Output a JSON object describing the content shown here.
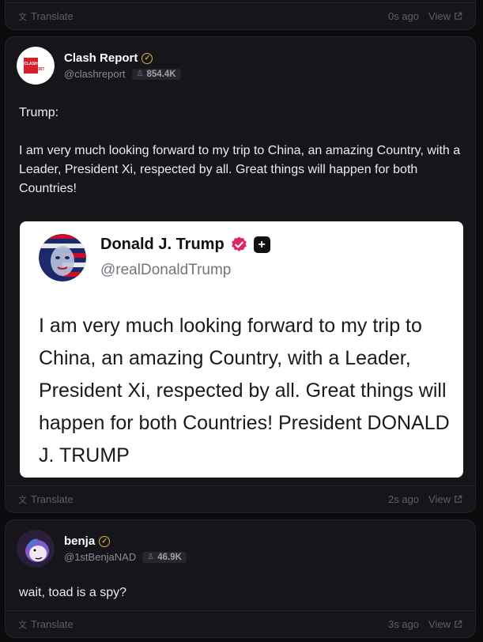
{
  "top_card": {
    "translate_label": "Translate",
    "time": "0s ago",
    "view_label": "View"
  },
  "post1": {
    "author_name": "Clash Report",
    "handle": "@clashreport",
    "followers": "854.4K",
    "avatar_text": "CLASH REPORT",
    "text": "Trump:\n\nI am very much looking forward to my trip to China, an amazing Country, with a Leader, President Xi, respected by all. Great things will happen for both Countries!",
    "quote": {
      "name": "Donald J. Trump",
      "handle": "@realDonaldTrump",
      "text": "I am very much looking forward to my trip to China, an amazing Country, with a Leader, President Xi, respected by all. Great things will happen for both Countries! President DONALD J. TRUMP",
      "badge_color": "#e0245e"
    },
    "translate_label": "Translate",
    "time": "2s ago",
    "view_label": "View"
  },
  "post2": {
    "author_name": "benja",
    "handle": "@1stBenjaNAD",
    "followers": "46.9K",
    "text": "wait, toad is a spy?",
    "translate_label": "Translate",
    "time": "3s ago",
    "view_label": "View"
  },
  "colors": {
    "background": "#0b0b0e",
    "card": "#15151a",
    "verified": "#e0b23a",
    "muted": "#5f5f6b"
  }
}
